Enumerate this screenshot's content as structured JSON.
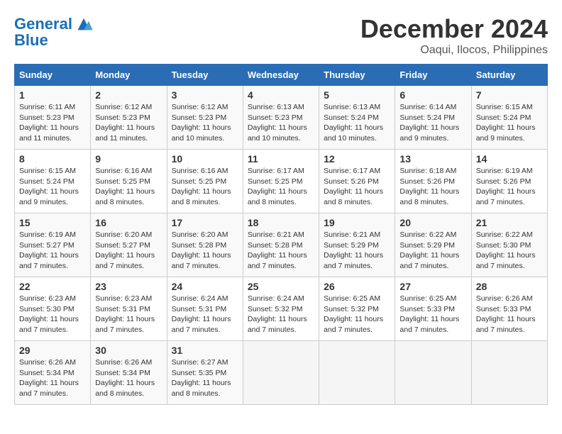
{
  "logo": {
    "line1": "General",
    "line2": "Blue"
  },
  "title": "December 2024",
  "location": "Oaqui, Ilocos, Philippines",
  "weekdays": [
    "Sunday",
    "Monday",
    "Tuesday",
    "Wednesday",
    "Thursday",
    "Friday",
    "Saturday"
  ],
  "weeks": [
    [
      {
        "day": "1",
        "sunrise": "Sunrise: 6:11 AM",
        "sunset": "Sunset: 5:23 PM",
        "daylight": "Daylight: 11 hours and 11 minutes."
      },
      {
        "day": "2",
        "sunrise": "Sunrise: 6:12 AM",
        "sunset": "Sunset: 5:23 PM",
        "daylight": "Daylight: 11 hours and 11 minutes."
      },
      {
        "day": "3",
        "sunrise": "Sunrise: 6:12 AM",
        "sunset": "Sunset: 5:23 PM",
        "daylight": "Daylight: 11 hours and 10 minutes."
      },
      {
        "day": "4",
        "sunrise": "Sunrise: 6:13 AM",
        "sunset": "Sunset: 5:23 PM",
        "daylight": "Daylight: 11 hours and 10 minutes."
      },
      {
        "day": "5",
        "sunrise": "Sunrise: 6:13 AM",
        "sunset": "Sunset: 5:24 PM",
        "daylight": "Daylight: 11 hours and 10 minutes."
      },
      {
        "day": "6",
        "sunrise": "Sunrise: 6:14 AM",
        "sunset": "Sunset: 5:24 PM",
        "daylight": "Daylight: 11 hours and 9 minutes."
      },
      {
        "day": "7",
        "sunrise": "Sunrise: 6:15 AM",
        "sunset": "Sunset: 5:24 PM",
        "daylight": "Daylight: 11 hours and 9 minutes."
      }
    ],
    [
      {
        "day": "8",
        "sunrise": "Sunrise: 6:15 AM",
        "sunset": "Sunset: 5:24 PM",
        "daylight": "Daylight: 11 hours and 9 minutes."
      },
      {
        "day": "9",
        "sunrise": "Sunrise: 6:16 AM",
        "sunset": "Sunset: 5:25 PM",
        "daylight": "Daylight: 11 hours and 8 minutes."
      },
      {
        "day": "10",
        "sunrise": "Sunrise: 6:16 AM",
        "sunset": "Sunset: 5:25 PM",
        "daylight": "Daylight: 11 hours and 8 minutes."
      },
      {
        "day": "11",
        "sunrise": "Sunrise: 6:17 AM",
        "sunset": "Sunset: 5:25 PM",
        "daylight": "Daylight: 11 hours and 8 minutes."
      },
      {
        "day": "12",
        "sunrise": "Sunrise: 6:17 AM",
        "sunset": "Sunset: 5:26 PM",
        "daylight": "Daylight: 11 hours and 8 minutes."
      },
      {
        "day": "13",
        "sunrise": "Sunrise: 6:18 AM",
        "sunset": "Sunset: 5:26 PM",
        "daylight": "Daylight: 11 hours and 8 minutes."
      },
      {
        "day": "14",
        "sunrise": "Sunrise: 6:19 AM",
        "sunset": "Sunset: 5:26 PM",
        "daylight": "Daylight: 11 hours and 7 minutes."
      }
    ],
    [
      {
        "day": "15",
        "sunrise": "Sunrise: 6:19 AM",
        "sunset": "Sunset: 5:27 PM",
        "daylight": "Daylight: 11 hours and 7 minutes."
      },
      {
        "day": "16",
        "sunrise": "Sunrise: 6:20 AM",
        "sunset": "Sunset: 5:27 PM",
        "daylight": "Daylight: 11 hours and 7 minutes."
      },
      {
        "day": "17",
        "sunrise": "Sunrise: 6:20 AM",
        "sunset": "Sunset: 5:28 PM",
        "daylight": "Daylight: 11 hours and 7 minutes."
      },
      {
        "day": "18",
        "sunrise": "Sunrise: 6:21 AM",
        "sunset": "Sunset: 5:28 PM",
        "daylight": "Daylight: 11 hours and 7 minutes."
      },
      {
        "day": "19",
        "sunrise": "Sunrise: 6:21 AM",
        "sunset": "Sunset: 5:29 PM",
        "daylight": "Daylight: 11 hours and 7 minutes."
      },
      {
        "day": "20",
        "sunrise": "Sunrise: 6:22 AM",
        "sunset": "Sunset: 5:29 PM",
        "daylight": "Daylight: 11 hours and 7 minutes."
      },
      {
        "day": "21",
        "sunrise": "Sunrise: 6:22 AM",
        "sunset": "Sunset: 5:30 PM",
        "daylight": "Daylight: 11 hours and 7 minutes."
      }
    ],
    [
      {
        "day": "22",
        "sunrise": "Sunrise: 6:23 AM",
        "sunset": "Sunset: 5:30 PM",
        "daylight": "Daylight: 11 hours and 7 minutes."
      },
      {
        "day": "23",
        "sunrise": "Sunrise: 6:23 AM",
        "sunset": "Sunset: 5:31 PM",
        "daylight": "Daylight: 11 hours and 7 minutes."
      },
      {
        "day": "24",
        "sunrise": "Sunrise: 6:24 AM",
        "sunset": "Sunset: 5:31 PM",
        "daylight": "Daylight: 11 hours and 7 minutes."
      },
      {
        "day": "25",
        "sunrise": "Sunrise: 6:24 AM",
        "sunset": "Sunset: 5:32 PM",
        "daylight": "Daylight: 11 hours and 7 minutes."
      },
      {
        "day": "26",
        "sunrise": "Sunrise: 6:25 AM",
        "sunset": "Sunset: 5:32 PM",
        "daylight": "Daylight: 11 hours and 7 minutes."
      },
      {
        "day": "27",
        "sunrise": "Sunrise: 6:25 AM",
        "sunset": "Sunset: 5:33 PM",
        "daylight": "Daylight: 11 hours and 7 minutes."
      },
      {
        "day": "28",
        "sunrise": "Sunrise: 6:26 AM",
        "sunset": "Sunset: 5:33 PM",
        "daylight": "Daylight: 11 hours and 7 minutes."
      }
    ],
    [
      {
        "day": "29",
        "sunrise": "Sunrise: 6:26 AM",
        "sunset": "Sunset: 5:34 PM",
        "daylight": "Daylight: 11 hours and 7 minutes."
      },
      {
        "day": "30",
        "sunrise": "Sunrise: 6:26 AM",
        "sunset": "Sunset: 5:34 PM",
        "daylight": "Daylight: 11 hours and 8 minutes."
      },
      {
        "day": "31",
        "sunrise": "Sunrise: 6:27 AM",
        "sunset": "Sunset: 5:35 PM",
        "daylight": "Daylight: 11 hours and 8 minutes."
      },
      null,
      null,
      null,
      null
    ]
  ]
}
